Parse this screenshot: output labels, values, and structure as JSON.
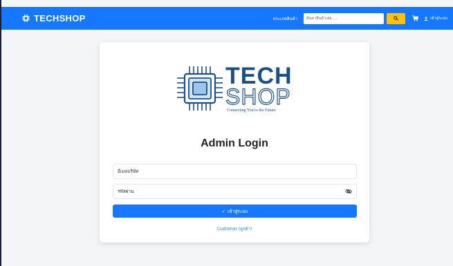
{
  "navbar": {
    "brand": "TECHSHOP",
    "category_link": "ประเภทสินค้า",
    "search_placeholder": "ค้นหาสินค้าเลย.....",
    "login_label": "เข้าสู่ระบบ"
  },
  "logo": {
    "line1": "TECH",
    "line2": "SHOP",
    "tagline": "Connecting You to the Future"
  },
  "login_card": {
    "title": "Admin Login",
    "username_placeholder": "อีเมลบริษัท",
    "password_placeholder": "รหัสผ่าน",
    "submit_label": "เข้าสู่ระบบ",
    "submit_check": "✓",
    "customer_link": "Customer (ลูกค้า)"
  },
  "colors": {
    "primary": "#1677ff",
    "search_button": "#ffc107",
    "logo": "#1b4f86",
    "card_background": "#ffffff",
    "page_background": "#f4f5f7"
  },
  "icons": {
    "brand": "chip-icon",
    "search": "search-icon",
    "cart": "cart-icon",
    "user": "user-icon",
    "password_toggle": "eye-slash-icon"
  }
}
